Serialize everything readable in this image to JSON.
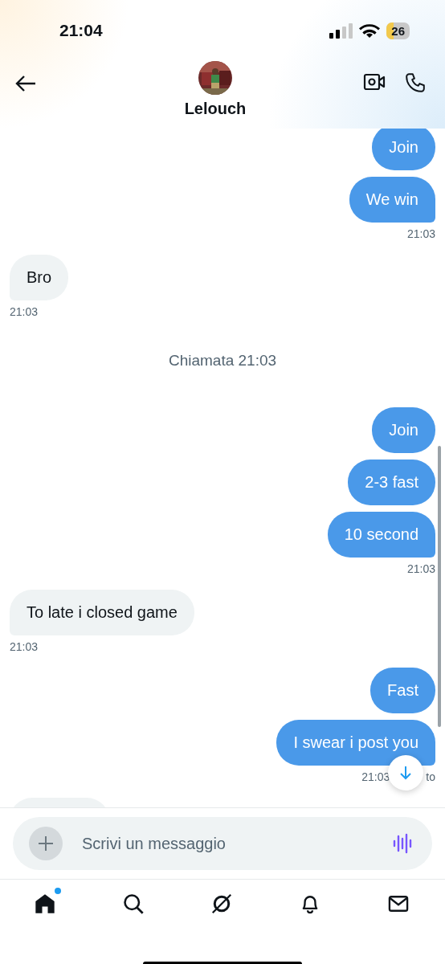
{
  "status_bar": {
    "time": "21:04",
    "battery": "26"
  },
  "header": {
    "name": "Lelouch"
  },
  "groups": [
    {
      "kind": "sent",
      "messages": [
        "Join",
        "We win"
      ],
      "time": "21:03"
    },
    {
      "kind": "received",
      "messages": [
        "Bro"
      ],
      "time": "21:03"
    },
    {
      "kind": "event",
      "text": "Chiamata 21:03"
    },
    {
      "kind": "sent",
      "messages": [
        "Join",
        "2-3 fast",
        "10 second"
      ],
      "time": "21:03"
    },
    {
      "kind": "received",
      "messages": [
        "To late i closed game"
      ],
      "time": "21:03"
    },
    {
      "kind": "sent",
      "messages": [
        "Fast",
        "I swear i post you"
      ],
      "time": "21:03",
      "status": "to"
    }
  ],
  "composer": {
    "placeholder": "Scrivi un messaggio"
  },
  "nav": [
    {
      "kind": "home",
      "selected": true,
      "badge": true
    },
    {
      "kind": "search",
      "selected": false,
      "badge": false
    },
    {
      "kind": "grok",
      "selected": false,
      "badge": false
    },
    {
      "kind": "bell",
      "selected": false,
      "badge": false
    },
    {
      "kind": "mail",
      "selected": false,
      "badge": false
    }
  ]
}
